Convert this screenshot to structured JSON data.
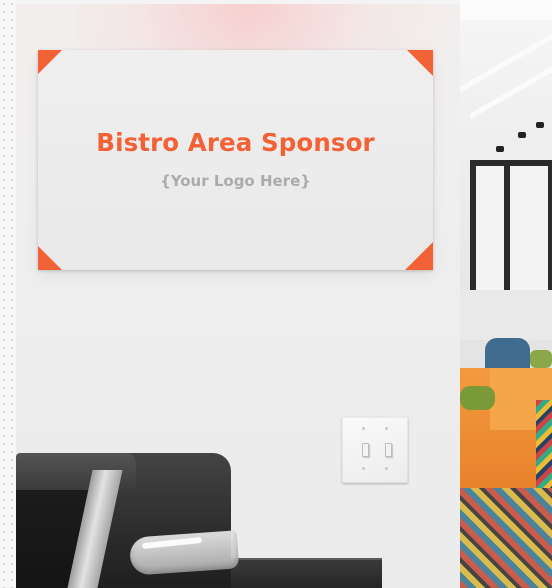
{
  "sign": {
    "title": "Bistro Area Sponsor",
    "subtitle": "{Your Logo Here}",
    "accent_color": "#f26236",
    "subtitle_color": "#ababab"
  },
  "scene_objects": {
    "light_switch": "double-toggle-light-switch",
    "appliance": "coffee-machine",
    "background": "office-lounge-with-orange-seating"
  }
}
